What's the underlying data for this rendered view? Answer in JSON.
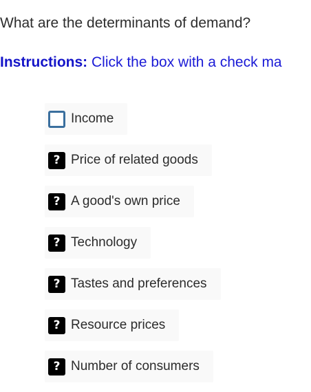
{
  "question": "What are the determinants of demand?",
  "instructions": {
    "label": "Instructions:",
    "text": " Click the box with a check ma"
  },
  "options": [
    {
      "label": "Income",
      "state": "unchecked",
      "icon": "empty-checkbox-icon"
    },
    {
      "label": "Price of related goods",
      "state": "unknown",
      "icon_text": "?",
      "icon": "question-mark-icon"
    },
    {
      "label": "A good's own price",
      "state": "unknown",
      "icon_text": "?",
      "icon": "question-mark-icon"
    },
    {
      "label": "Technology",
      "state": "unknown",
      "icon_text": "?",
      "icon": "question-mark-icon"
    },
    {
      "label": "Tastes and preferences",
      "state": "unknown",
      "icon_text": "?",
      "icon": "question-mark-icon"
    },
    {
      "label": "Resource prices",
      "state": "unknown",
      "icon_text": "?",
      "icon": "question-mark-icon"
    },
    {
      "label": "Number of consumers",
      "state": "unknown",
      "icon_text": "?",
      "icon": "question-mark-icon"
    }
  ],
  "colors": {
    "instructions": "#1a1ad6",
    "checkbox_border": "#3a6f9e",
    "unknown_box": "#000000",
    "option_bg": "#f9f9f9"
  }
}
